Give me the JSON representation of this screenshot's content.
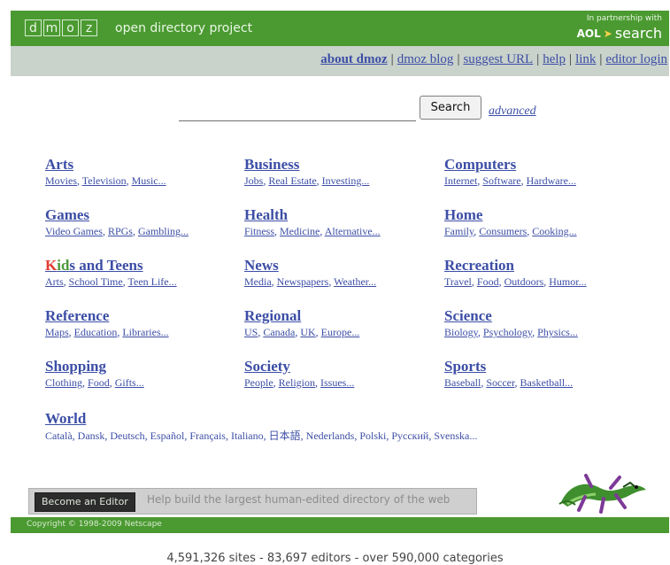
{
  "brand": {
    "letters": [
      "d",
      "m",
      "o",
      "z"
    ],
    "tagline": "open directory project",
    "partner_label": "In partnership with",
    "partner_name": "AOL",
    "partner_service": "search"
  },
  "nav": {
    "about": "about dmoz",
    "blog": "dmoz blog",
    "suggest": "suggest URL",
    "help": "help",
    "link": "link",
    "editor_login": "editor login",
    "separator": "|"
  },
  "search": {
    "value": "",
    "button": "Search",
    "advanced": "advanced"
  },
  "categories": [
    {
      "title": "Arts",
      "subs": [
        "Movies",
        "Television",
        "Music..."
      ]
    },
    {
      "title": "Business",
      "subs": [
        "Jobs",
        "Real Estate",
        "Investing..."
      ]
    },
    {
      "title": "Computers",
      "subs": [
        "Internet",
        "Software",
        "Hardware..."
      ]
    },
    {
      "title": "Games",
      "subs": [
        "Video Games",
        "RPGs",
        "Gambling..."
      ]
    },
    {
      "title": "Health",
      "subs": [
        "Fitness",
        "Medicine",
        "Alternative..."
      ]
    },
    {
      "title": "Home",
      "subs": [
        "Family",
        "Consumers",
        "Cooking..."
      ]
    },
    {
      "title": "Kids and Teens",
      "subs": [
        "Arts",
        "School Time",
        "Teen Life..."
      ]
    },
    {
      "title": "News",
      "subs": [
        "Media",
        "Newspapers",
        "Weather..."
      ]
    },
    {
      "title": "Recreation",
      "subs": [
        "Travel",
        "Food",
        "Outdoors",
        "Humor..."
      ]
    },
    {
      "title": "Reference",
      "subs": [
        "Maps",
        "Education",
        "Libraries..."
      ]
    },
    {
      "title": "Regional",
      "subs": [
        "US",
        "Canada",
        "UK",
        "Europe..."
      ]
    },
    {
      "title": "Science",
      "subs": [
        "Biology",
        "Psychology",
        "Physics..."
      ]
    },
    {
      "title": "Shopping",
      "subs": [
        "Clothing",
        "Food",
        "Gifts..."
      ]
    },
    {
      "title": "Society",
      "subs": [
        "People",
        "Religion",
        "Issues..."
      ]
    },
    {
      "title": "Sports",
      "subs": [
        "Baseball",
        "Soccer",
        "Basketball..."
      ]
    }
  ],
  "world": {
    "title": "World",
    "languages": [
      "Català",
      "Dansk",
      "Deutsch",
      "Español",
      "Français",
      "Italiano",
      "日本語",
      "Nederlands",
      "Polski",
      "Русский",
      "Svenska..."
    ]
  },
  "editor_banner": {
    "button": "Become an Editor",
    "text": "Help build the largest human-edited directory of the web"
  },
  "footer": {
    "copyright": "Copyright © 1998-2009 Netscape",
    "stats": "4,591,326 sites - 83,697 editors - over 590,000 categories"
  },
  "colors": {
    "green": "#4b9a31",
    "nav_gray": "#c9d2cb",
    "link_blue": "#3c4ea6"
  }
}
